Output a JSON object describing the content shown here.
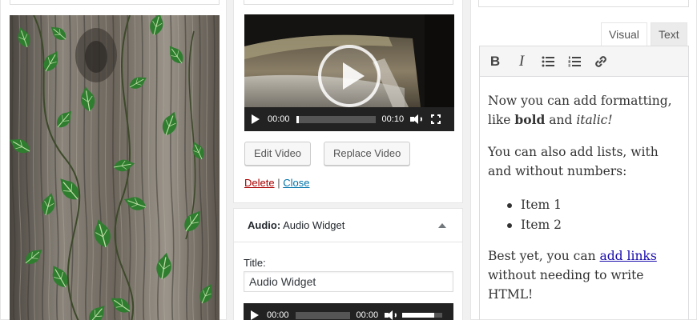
{
  "video_widget": {
    "current_time": "00:00",
    "duration": "00:10",
    "progress_fraction": 0.03,
    "edit_label": "Edit Video",
    "replace_label": "Replace Video",
    "delete_label": "Delete",
    "separator": "|",
    "close_label": "Close"
  },
  "audio_widget": {
    "header_type": "Audio:",
    "header_name": "Audio Widget",
    "title_label": "Title:",
    "title_value": "Audio Widget",
    "current_time": "00:00",
    "duration": "00:00",
    "volume_fraction": 0.8
  },
  "text_widget": {
    "tab_visual": "Visual",
    "tab_text": "Text",
    "toolbar": [
      "bold",
      "italic",
      "bulleted-list",
      "numbered-list",
      "link"
    ],
    "toolbar_bold_glyph": "B",
    "toolbar_italic_glyph": "I",
    "content": {
      "p1_a": "Now you can add formatting, like ",
      "p1_bold": "bold",
      "p1_b": " and ",
      "p1_italic": "italic!",
      "p2": "You can also add lists, with and without numbers:",
      "list": [
        "Item 1",
        "Item 2"
      ],
      "p3_a": "Best yet, you can ",
      "p3_link": "add links",
      "p3_b": " without needing to write HTML!"
    }
  },
  "colors": {
    "link_delete": "#a00000",
    "link_close": "#0073aa",
    "content_link": "#1a0dab",
    "player_bg": "#222222"
  }
}
